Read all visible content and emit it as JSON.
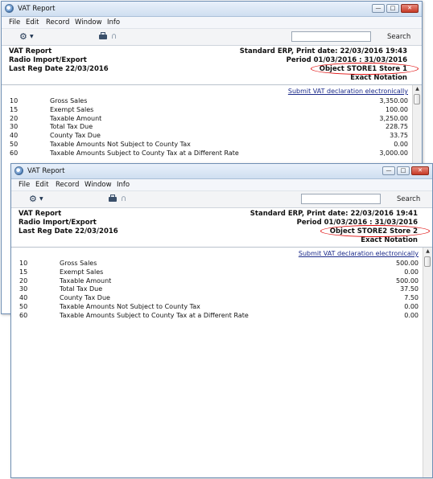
{
  "windows": [
    {
      "title": "VAT Report",
      "menu": [
        "File",
        "Edit",
        "Record",
        "Window",
        "Info"
      ],
      "search_label": "Search",
      "header": {
        "title": "VAT Report",
        "register": "Radio Import/Export",
        "last_reg_date": "Last Reg Date  22/03/2016",
        "company_print": "Standard ERP, Print date: 22/03/2016 19:43",
        "period": "Period  01/03/2016 : 31/03/2016",
        "object": "Object  STORE1  Store 1",
        "notation": "Exact Notation"
      },
      "submit_link": "Submit VAT declaration electronically",
      "rows": [
        {
          "code": "10",
          "desc": "Gross Sales",
          "amount": "3,350.00"
        },
        {
          "code": "15",
          "desc": "Exempt Sales",
          "amount": "100.00"
        },
        {
          "code": "20",
          "desc": "Taxable Amount",
          "amount": "3,250.00"
        },
        {
          "code": "30",
          "desc": "Total Tax Due",
          "amount": "228.75"
        },
        {
          "code": "40",
          "desc": "County Tax Due",
          "amount": "33.75"
        },
        {
          "code": "50",
          "desc": "Taxable Amounts Not Subject to County Tax",
          "amount": "0.00"
        },
        {
          "code": "60",
          "desc": "Taxable Amounts Subject to County Tax at a Different Rate",
          "amount": "3,000.00"
        }
      ]
    },
    {
      "title": "VAT Report",
      "menu": [
        "File",
        "Edit",
        "Record",
        "Window",
        "Info"
      ],
      "search_label": "Search",
      "header": {
        "title": "VAT Report",
        "register": "Radio Import/Export",
        "last_reg_date": "Last Reg Date  22/03/2016",
        "company_print": "Standard ERP, Print date: 22/03/2016 19:41",
        "period": "Period  01/03/2016 : 31/03/2016",
        "object": "Object  STORE2  Store 2",
        "notation": "Exact Notation"
      },
      "submit_link": "Submit VAT declaration electronically",
      "rows": [
        {
          "code": "10",
          "desc": "Gross Sales",
          "amount": "500.00"
        },
        {
          "code": "15",
          "desc": "Exempt Sales",
          "amount": "0.00"
        },
        {
          "code": "20",
          "desc": "Taxable Amount",
          "amount": "500.00"
        },
        {
          "code": "30",
          "desc": "Total Tax Due",
          "amount": "37.50"
        },
        {
          "code": "40",
          "desc": "County Tax Due",
          "amount": "7.50"
        },
        {
          "code": "50",
          "desc": "Taxable Amounts Not Subject to County Tax",
          "amount": "0.00"
        },
        {
          "code": "60",
          "desc": "Taxable Amounts Subject to County Tax at a Different Rate",
          "amount": "0.00"
        }
      ]
    }
  ],
  "colors": {
    "highlight_oval": "#e01010",
    "link": "#1b2a8a",
    "close_button": "#c63a25"
  },
  "icons": [
    "app-icon",
    "minimize-icon",
    "maximize-icon",
    "close-icon",
    "gear-icon",
    "chevron-down-icon",
    "printer-icon",
    "paperclip-icon",
    "scroll-up-icon"
  ]
}
